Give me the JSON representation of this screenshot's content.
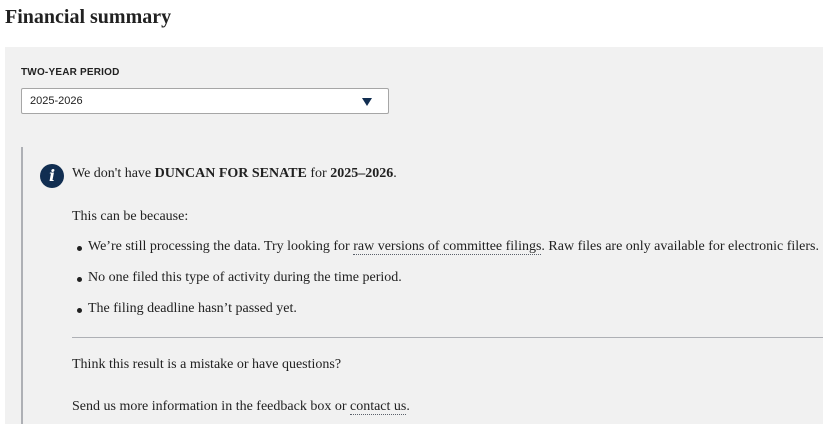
{
  "page_title": "Financial summary",
  "period": {
    "label": "TWO-YEAR PERIOD",
    "selected": "2025-2026"
  },
  "message": {
    "icon": "info-icon",
    "headline_prefix": "We don't have ",
    "committee": "DUNCAN FOR SENATE",
    "headline_middle": " for ",
    "headline_period": "2025–2026",
    "headline_suffix": ".",
    "because": "This can be because:",
    "reasons": [
      {
        "before": "We’re still processing the data. Try looking for ",
        "link": "raw versions of committee filings",
        "after": ". Raw files are only available for electronic filers."
      },
      {
        "text": "No one filed this type of activity during the time period."
      },
      {
        "text": "The filing deadline hasn’t passed yet."
      }
    ],
    "question": "Think this result is a mistake or have questions?",
    "send_prefix": "Send us more information in the feedback box or ",
    "send_link": "contact us",
    "send_suffix": "."
  },
  "colors": {
    "panel_bg": "#f1f1f1",
    "icon_bg": "#112e51",
    "border": "#aeb0b5"
  }
}
